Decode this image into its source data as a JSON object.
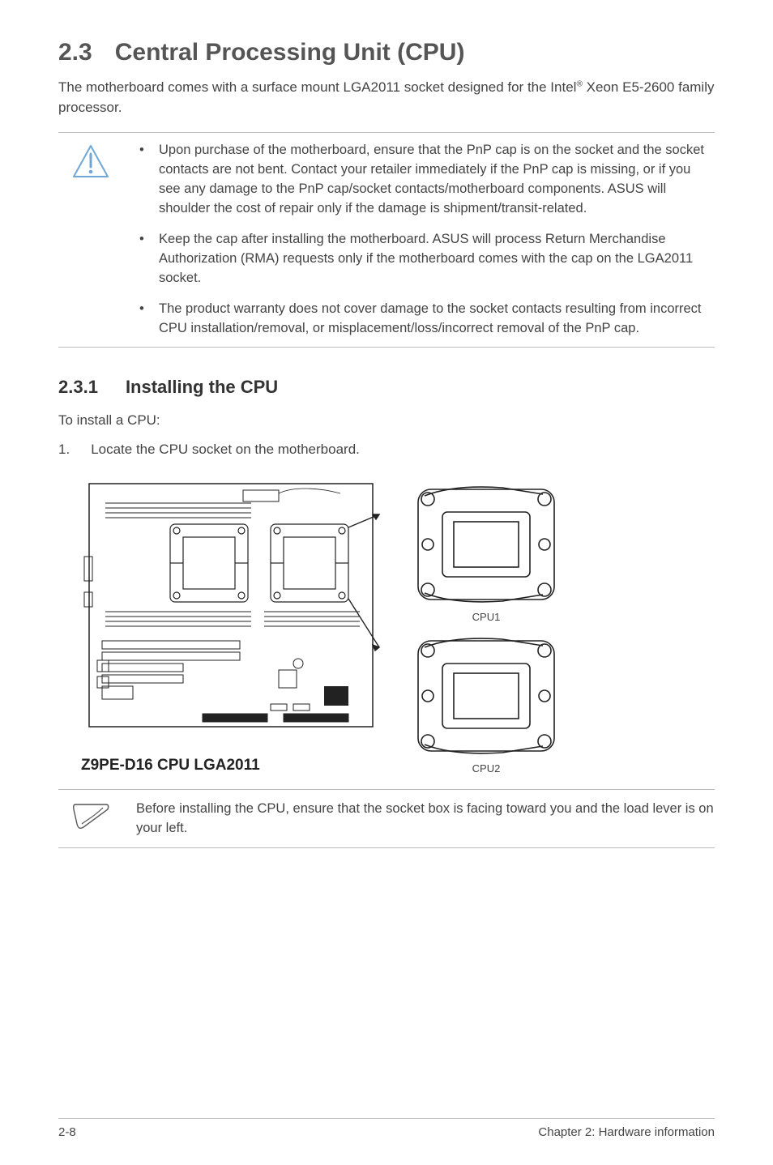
{
  "section": {
    "number": "2.3",
    "title": "Central Processing Unit (CPU)"
  },
  "intro": {
    "part1": "The motherboard comes with a surface mount LGA2011 socket designed for the Intel",
    "reg": "®",
    "part2": " Xeon E5-2600 family processor."
  },
  "warnings": [
    "Upon purchase of the motherboard, ensure that the PnP cap is on the socket and the socket contacts are not bent. Contact your retailer immediately if the PnP cap is missing, or if you see any damage to the PnP cap/socket contacts/motherboard components. ASUS will shoulder the cost of repair only if the damage is shipment/transit-related.",
    "Keep the cap after installing the motherboard. ASUS will process Return Merchandise Authorization (RMA) requests only if the motherboard comes with the cap on the LGA2011 socket.",
    "The product warranty does not cover damage to the socket contacts resulting from incorrect CPU installation/removal, or misplacement/loss/incorrect removal of the PnP cap."
  ],
  "subsection": {
    "number": "2.3.1",
    "title": "Installing the CPU"
  },
  "step_intro": "To install a CPU:",
  "steps": [
    {
      "n": "1.",
      "text": "Locate the CPU socket on the motherboard."
    }
  ],
  "figure": {
    "board_caption": "Z9PE-D16 CPU LGA2011",
    "socket1_label": "CPU1",
    "socket2_label": "CPU2"
  },
  "note": "Before installing the CPU, ensure that the socket box is facing toward you and the load lever is on your left.",
  "footer": {
    "left": "2-8",
    "right": "Chapter 2: Hardware information"
  }
}
